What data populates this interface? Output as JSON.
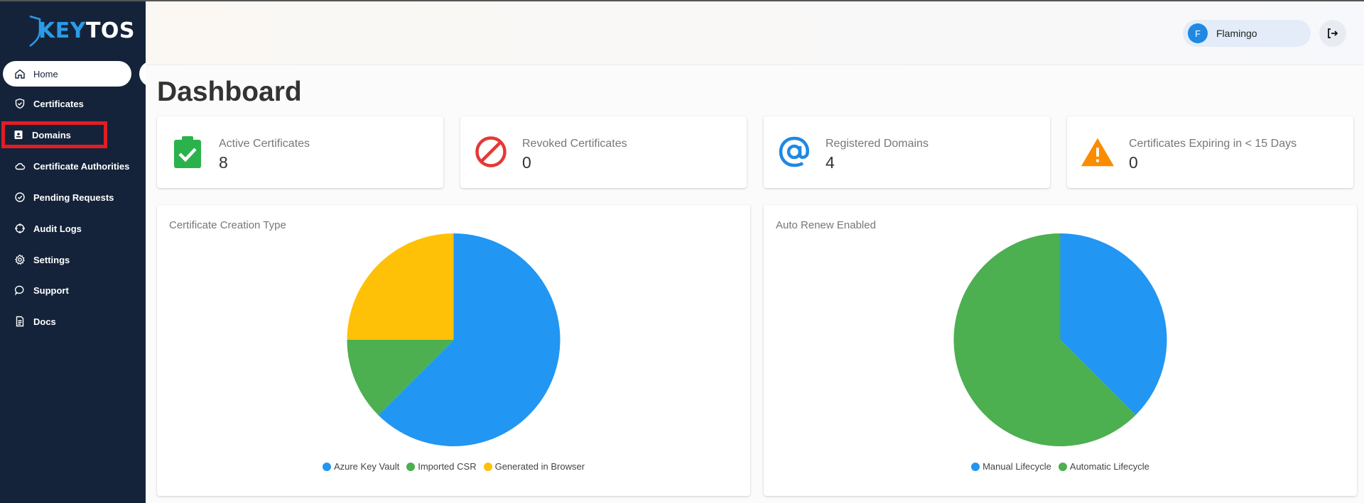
{
  "brand": {
    "key": "KEY",
    "tos": "TOS"
  },
  "sidebar": {
    "items": [
      {
        "label": "Home",
        "icon": "home-icon"
      },
      {
        "label": "Certificates",
        "icon": "shield-check-icon"
      },
      {
        "label": "Domains",
        "icon": "id-badge-icon"
      },
      {
        "label": "Certificate Authorities",
        "icon": "cloud-icon"
      },
      {
        "label": "Pending Requests",
        "icon": "check-circle-icon"
      },
      {
        "label": "Audit Logs",
        "icon": "crosshair-icon"
      },
      {
        "label": "Settings",
        "icon": "gear-icon"
      },
      {
        "label": "Support",
        "icon": "chat-bubble-icon"
      },
      {
        "label": "Docs",
        "icon": "document-icon"
      }
    ]
  },
  "header": {
    "user_initial": "F",
    "user_name": "Flamingo"
  },
  "page": {
    "title": "Dashboard"
  },
  "stats": [
    {
      "label": "Active Certificates",
      "value": "8",
      "icon": "clipboard-check-icon",
      "color": "#2bb24c"
    },
    {
      "label": "Revoked Certificates",
      "value": "0",
      "icon": "prohibited-icon",
      "color": "#e53935"
    },
    {
      "label": "Registered Domains",
      "value": "4",
      "icon": "at-sign-icon",
      "color": "#1e88e5"
    },
    {
      "label": "Certificates Expiring in < 15 Days",
      "value": "0",
      "icon": "warning-triangle-icon",
      "color": "#fb8c00"
    }
  ],
  "chart_data": [
    {
      "type": "pie",
      "title": "Certificate Creation Type",
      "categories": [
        "Azure Key Vault",
        "Imported CSR",
        "Generated in Browser"
      ],
      "values": [
        5,
        1,
        2
      ],
      "colors": [
        "#2196f3",
        "#4caf50",
        "#ffc107"
      ],
      "legend": "bottom"
    },
    {
      "type": "pie",
      "title": "Auto Renew Enabled",
      "categories": [
        "Manual Lifecycle",
        "Automatic Lifecycle"
      ],
      "values": [
        3,
        5
      ],
      "colors": [
        "#2196f3",
        "#4caf50"
      ],
      "legend": "bottom"
    }
  ]
}
